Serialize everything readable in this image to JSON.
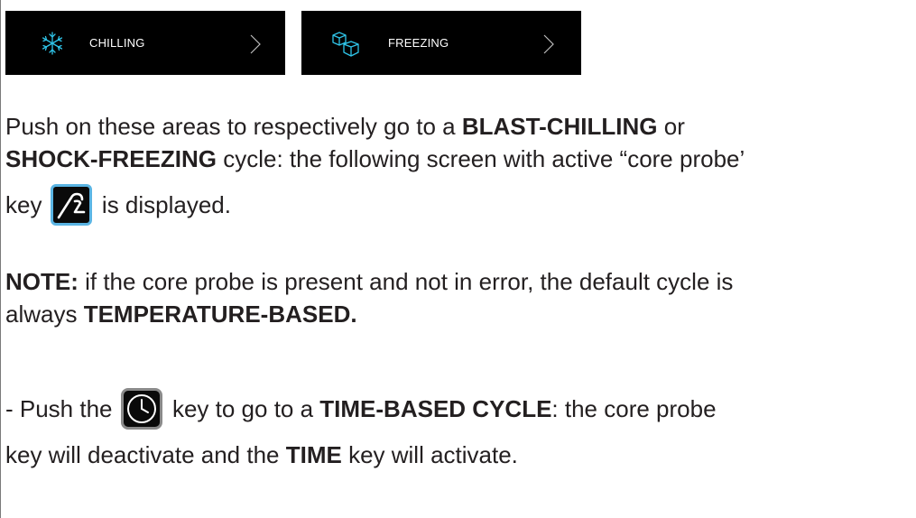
{
  "tiles": {
    "chilling": {
      "label": "CHILLING",
      "icon": "snowflake-icon"
    },
    "freezing": {
      "label": "FREEZING",
      "icon": "ice-cubes-icon"
    }
  },
  "colors": {
    "tile_bg": "#000000",
    "icon_accent": "#2fc4e8",
    "probe_key_border": "#5ab4e3"
  },
  "paragraph1": {
    "l1_a": "Push on these areas to respectively go to a ",
    "l1_b": "BLAST-CHILLING",
    "l1_c": " or",
    "l2_a": "SHOCK-FREEZING",
    "l2_b": " cycle: the following screen with active “core probe’",
    "l3_a": "key ",
    "l3_b": " is displayed."
  },
  "paragraph2": {
    "l1_a": "NOTE:",
    "l1_b": " if the core probe is present and not in error, the default cycle is",
    "l2_a": "always ",
    "l2_b": "TEMPERATURE-BASED."
  },
  "paragraph3": {
    "l1_a": "- Push the ",
    "l1_b": " key to go to a ",
    "l1_c": "TIME-BASED CYCLE",
    "l1_d": ": the core probe",
    "l2_a": "key will deactivate and the ",
    "l2_b": "TIME",
    "l2_c": " key will activate."
  }
}
